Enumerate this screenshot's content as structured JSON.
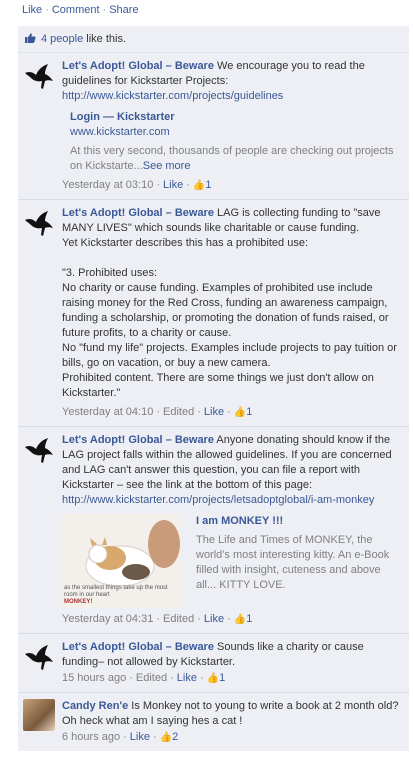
{
  "top_actions": {
    "like": "Like",
    "comment": "Comment",
    "share": "Share"
  },
  "likes_summary": {
    "count_link": "4 people",
    "suffix": " like this."
  },
  "comments": [
    {
      "author": "Let's Adopt! Global – Beware",
      "text": "We encourage you to read the guidelines for Kickstarter Projects:",
      "link": "http://www.kickstarter.com/projects/guidelines",
      "share": {
        "title": "Login — Kickstarter",
        "domain": "www.kickstarter.com",
        "desc": "At this very second, thousands of people are checking out projects on Kickstarte...",
        "see_more": "See more"
      },
      "time": "Yesterday at 03:10",
      "edited": "",
      "like_label": "Like",
      "like_count": "1"
    },
    {
      "author": "Let's Adopt! Global – Beware",
      "text": "LAG is collecting funding to \"save MANY LIVES\" which sounds like charitable or cause funding.\nYet Kickstarter describes this has a prohibited use:\n\n\"3. Prohibited uses:\nNo charity or cause funding. Examples of prohibited use include raising money for the Red Cross, funding an awareness campaign, funding a scholarship, or promoting the donation of funds raised, or future profits, to a charity or cause.\nNo \"fund my life\" projects. Examples include projects to pay tuition or bills, go on vacation, or buy a new camera.\nProhibited content. There are some things we just don't allow on Kickstarter.\"",
      "time": "Yesterday at 04:10",
      "edited": "Edited",
      "like_label": "Like",
      "like_count": "1"
    },
    {
      "author": "Let's Adopt! Global – Beware",
      "text": "Anyone donating should know if the LAG project falls within the allowed guidelines. If you are concerned and LAG can't answer this question, you can file a report with Kickstarter – see the link at the bottom of this page:",
      "link": "http://www.kickstarter.com/projects/letsadoptglobal/i-am-monkey",
      "media": {
        "title": "I am MONKEY !!!",
        "desc": "The Life and Times of MONKEY, the world's most interesting kitty. An e-Book filled with insight, cuteness and above all... KITTY LOVE.",
        "caption_small": "as the smallest things take up the most room in our heart",
        "caption_name": "MONKEY!"
      },
      "time": "Yesterday at 04:31",
      "edited": "Edited",
      "like_label": "Like",
      "like_count": "1"
    },
    {
      "author": "Let's Adopt! Global – Beware",
      "text": "Sounds like a charity or cause funding– not allowed by Kickstarter.",
      "time": "15 hours ago",
      "edited": "Edited",
      "like_label": "Like",
      "like_count": "1"
    },
    {
      "author": "Candy Ren'e",
      "text": "Is Monkey not to young to write a book at 2 month old?Oh heck what am I saying hes a cat !",
      "time": "6 hours ago",
      "edited": "",
      "like_label": "Like",
      "like_count": "2"
    }
  ],
  "colors": {
    "link": "#3b5998",
    "panel": "#edeff4",
    "meta": "#808080"
  }
}
